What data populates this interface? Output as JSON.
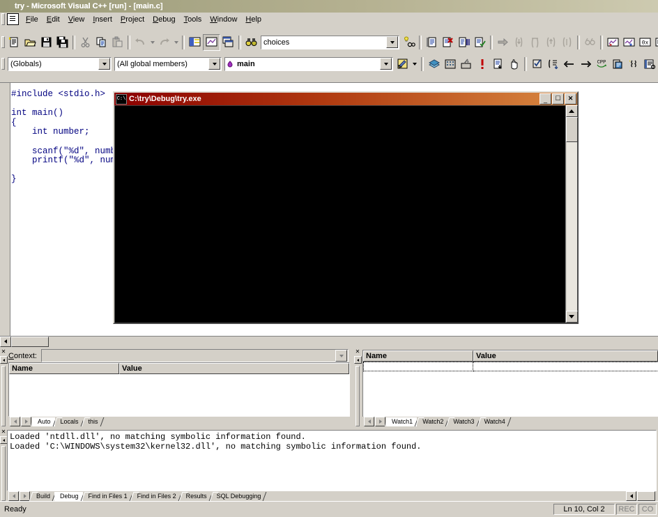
{
  "window": {
    "title": "try - Microsoft Visual C++ [run] - [main.c]",
    "app_icon": "visual-cpp-icon"
  },
  "menu": {
    "items": [
      {
        "label": "File"
      },
      {
        "label": "Edit"
      },
      {
        "label": "View"
      },
      {
        "label": "Insert"
      },
      {
        "label": "Project"
      },
      {
        "label": "Debug"
      },
      {
        "label": "Tools"
      },
      {
        "label": "Window"
      },
      {
        "label": "Help"
      }
    ]
  },
  "toolbar_standard": {
    "buttons": [
      {
        "name": "new-text-file-button",
        "icon": "new-file-icon"
      },
      {
        "name": "open-button",
        "icon": "open-folder-icon"
      },
      {
        "name": "save-button",
        "icon": "floppy-disk-icon"
      },
      {
        "name": "save-all-button",
        "icon": "save-all-icon"
      },
      {
        "name": "cut-button",
        "icon": "scissors-icon"
      },
      {
        "name": "copy-button",
        "icon": "copy-icon"
      },
      {
        "name": "paste-button",
        "icon": "paste-icon"
      },
      {
        "name": "undo-button",
        "icon": "undo-arrow-icon"
      },
      {
        "name": "redo-button",
        "icon": "redo-arrow-icon"
      },
      {
        "name": "workspace-button",
        "icon": "workspace-icon"
      },
      {
        "name": "output-window-button",
        "icon": "output-window-icon"
      },
      {
        "name": "window-list-button",
        "icon": "window-list-icon"
      }
    ],
    "find_combo": {
      "name": "find-combo",
      "value": "choices",
      "icon": "binoculars-icon"
    },
    "find_in_files_button": {
      "name": "find-in-files-button",
      "icon": "binoculars-bulb-icon"
    },
    "debug_buttons": [
      {
        "name": "restart-button",
        "icon": "restart-icon"
      },
      {
        "name": "stop-debugging-button",
        "icon": "stop-debug-icon"
      },
      {
        "name": "break-execution-button",
        "icon": "break-execution-icon"
      },
      {
        "name": "apply-code-changes-button",
        "icon": "apply-code-changes-icon"
      },
      {
        "name": "show-next-statement-button",
        "icon": "next-statement-icon"
      },
      {
        "name": "step-into-button",
        "icon": "step-into-icon"
      },
      {
        "name": "step-over-button",
        "icon": "step-over-icon"
      },
      {
        "name": "step-out-button",
        "icon": "step-out-icon"
      },
      {
        "name": "run-to-cursor-button",
        "icon": "run-to-cursor-icon"
      },
      {
        "name": "quickwatch-button",
        "icon": "quickwatch-icon"
      },
      {
        "name": "watch-window-button",
        "icon": "watch-window-icon"
      },
      {
        "name": "variables-window-button",
        "icon": "variables-window-icon"
      },
      {
        "name": "registers-window-button",
        "icon": "registers-window-icon"
      },
      {
        "name": "memory-window-button",
        "icon": "memory-window-icon"
      }
    ]
  },
  "toolbar_wizard": {
    "class_combo": {
      "name": "class-combo",
      "value": "(Globals)"
    },
    "member_combo": {
      "name": "member-combo",
      "value": "(All global members)"
    },
    "symbol_combo": {
      "name": "symbol-combo",
      "value": "main",
      "icon": "function-member-icon"
    },
    "wizardbar_action_button": {
      "name": "wizardbar-action-button",
      "icon": "wizard-wand-icon"
    },
    "buttons": [
      {
        "name": "compile-button",
        "icon": "compile-icon"
      },
      {
        "name": "build-button",
        "icon": "build-icon"
      },
      {
        "name": "stop-build-button",
        "icon": "stop-build-icon"
      },
      {
        "name": "insert-remove-breakpoint-button",
        "icon": "breakpoint-icon"
      },
      {
        "name": "go-button",
        "icon": "go-icon"
      },
      {
        "name": "hand-button",
        "icon": "hand-icon"
      },
      {
        "name": "edit-button",
        "icon": "edit-check-icon"
      },
      {
        "name": "properties-button",
        "icon": "properties-icon"
      },
      {
        "name": "navigate-back-button",
        "icon": "arrow-left-icon"
      },
      {
        "name": "navigate-forward-button",
        "icon": "arrow-right-icon"
      },
      {
        "name": "cpp-reference-button",
        "icon": "cpp-icon"
      },
      {
        "name": "clipboard-ring-button",
        "icon": "clipboard-icon"
      },
      {
        "name": "braces-button",
        "icon": "braces-icon"
      },
      {
        "name": "list-members-button",
        "icon": "list-members-icon"
      }
    ]
  },
  "editor": {
    "name": "source-editor",
    "filename": "main.c",
    "code": "#include <stdio.h>\n\nint main()\n{\n    int number;\n\n    scanf(\"%d\", number);\n    printf(\"%d\", number);\n\n}"
  },
  "console": {
    "title": "C:\\try\\Debug\\try.exe",
    "icon": "console-window-icon",
    "screen_text": "",
    "buttons": {
      "minimize": "_",
      "maximize": "▫",
      "close": "✕"
    }
  },
  "variables_pane": {
    "name": "variables-pane",
    "context_label": "Context:",
    "context_value": "",
    "columns": [
      "Name",
      "Value"
    ],
    "rows": [],
    "tabs": [
      {
        "label": "Auto",
        "active": true
      },
      {
        "label": "Locals",
        "active": false
      },
      {
        "label": "this",
        "active": false
      }
    ]
  },
  "watch_pane": {
    "name": "watch-pane",
    "columns": [
      "Name",
      "Value"
    ],
    "rows": [
      {
        "name": "",
        "value": ""
      }
    ],
    "tabs": [
      {
        "label": "Watch1",
        "active": true
      },
      {
        "label": "Watch2",
        "active": false
      },
      {
        "label": "Watch3",
        "active": false
      },
      {
        "label": "Watch4",
        "active": false
      }
    ]
  },
  "output_pane": {
    "name": "output-pane",
    "text": "Loaded 'ntdll.dll', no matching symbolic information found.\nLoaded 'C:\\WINDOWS\\system32\\kernel32.dll', no matching symbolic information found.",
    "tabs": [
      {
        "label": "Build",
        "active": false
      },
      {
        "label": "Debug",
        "active": true
      },
      {
        "label": "Find in Files 1",
        "active": false
      },
      {
        "label": "Find in Files 2",
        "active": false
      },
      {
        "label": "Results",
        "active": false
      },
      {
        "label": "SQL Debugging",
        "active": false
      }
    ]
  },
  "statusbar": {
    "message": "Ready",
    "position": "Ln 10, Col 2",
    "rec": "REC",
    "col": "CO",
    "ovr": ""
  },
  "colors": {
    "face": "#d4d0c8",
    "title_start": "#9a9a78",
    "title_end": "#cdcab0",
    "console_title_start": "#8b0000",
    "console_title_end": "#d98a42",
    "code_text": "#000080",
    "console_screen": "#000000"
  }
}
